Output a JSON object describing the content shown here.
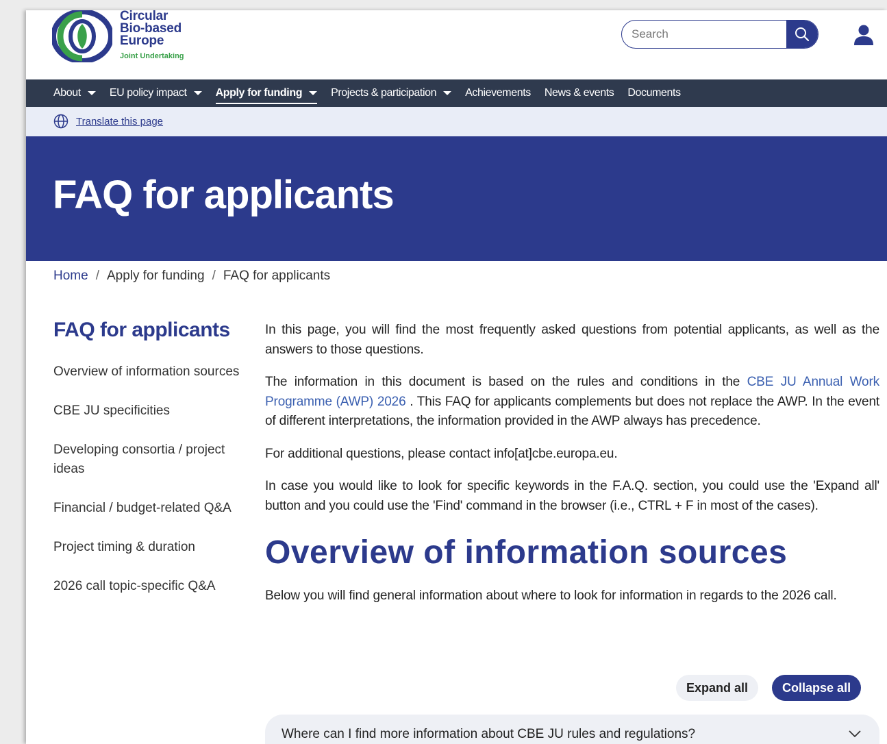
{
  "logo": {
    "line1": "Circular",
    "line2": "Bio-based",
    "line3": "Europe",
    "sub": "Joint Undertaking",
    "colors": {
      "blue": "#2c3a8c",
      "green": "#3aa14a"
    }
  },
  "search": {
    "placeholder": "Search",
    "value": ""
  },
  "nav": {
    "items": [
      {
        "label": "About",
        "dropdown": true
      },
      {
        "label": "EU policy impact",
        "dropdown": true
      },
      {
        "label": "Apply for funding",
        "dropdown": true,
        "active": true
      },
      {
        "label": "Projects & participation",
        "dropdown": true
      },
      {
        "label": "Achievements",
        "dropdown": false
      },
      {
        "label": "News & events",
        "dropdown": false
      },
      {
        "label": "Documents",
        "dropdown": false
      }
    ]
  },
  "translate": {
    "label": "Translate this page"
  },
  "hero": {
    "title": "FAQ for applicants"
  },
  "breadcrumb": [
    "Home",
    "Apply for funding",
    "FAQ for applicants"
  ],
  "sidebar": {
    "title": "FAQ for applicants",
    "items": [
      "Overview of information sources",
      "CBE JU specificities",
      "Developing consortia / project ideas",
      "Financial / budget-related Q&A",
      "Project timing & duration",
      "2026 call topic-specific Q&A"
    ]
  },
  "main": {
    "p1": "In this page, you will find the most frequently asked questions from potential applicants, as well as the answers to those questions.",
    "p2_pre": "The information in this document is based on the rules and conditions in the ",
    "p2_link": "CBE JU Annual Work Programme (AWP) 2026",
    "p2_post": " . This FAQ for applicants complements but does not replace the AWP. In the event of different interpretations, the information provided in the AWP always has precedence.",
    "p3": "For additional questions, please contact info[at]cbe.europa.eu.",
    "p4": "In case you would like to look for specific keywords in the F.A.Q. section, you could use the 'Expand all' button and you could use the 'Find' command in the browser (i.e., CTRL + F in most of the cases).",
    "section_title": "Overview of information sources",
    "section_text": "Below you will find general information about where to look for information in regards to the 2026 call.",
    "expand_label": "Expand all",
    "collapse_label": "Collapse all",
    "accordion_question": "Where can I find more information about CBE JU rules and regulations?"
  },
  "icons": {
    "search": "search-icon",
    "user": "user-icon",
    "globe": "globe-icon",
    "chevron": "chevron-down-icon",
    "caret": "caret-down-icon"
  }
}
